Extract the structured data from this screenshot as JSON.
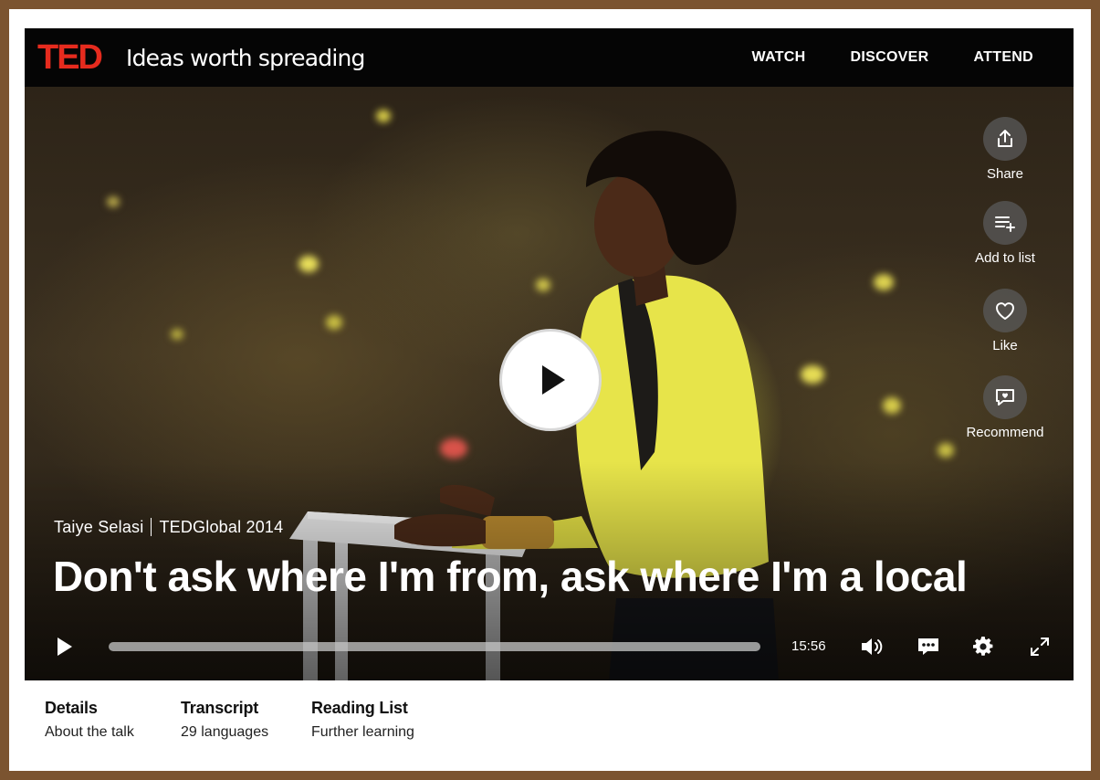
{
  "brand": {
    "logo": "TED",
    "tagline": "Ideas worth spreading",
    "accent": "#e62b1e"
  },
  "nav": {
    "items": [
      "WATCH",
      "DISCOVER",
      "ATTEND"
    ]
  },
  "actions": {
    "share": "Share",
    "add_to_list": "Add to list",
    "like": "Like",
    "recommend": "Recommend"
  },
  "talk": {
    "speaker": "Taiye Selasi",
    "event": "TEDGlobal 2014",
    "title": "Don't ask where I'm from, ask where I'm a local"
  },
  "player": {
    "duration": "15:56",
    "progress": 0,
    "icons": [
      "play-icon",
      "volume-icon",
      "captions-icon",
      "settings-icon",
      "fullscreen-icon"
    ]
  },
  "tabs": [
    {
      "title": "Details",
      "subtitle": "About the talk"
    },
    {
      "title": "Transcript",
      "subtitle": "29 languages"
    },
    {
      "title": "Reading List",
      "subtitle": "Further learning"
    }
  ]
}
